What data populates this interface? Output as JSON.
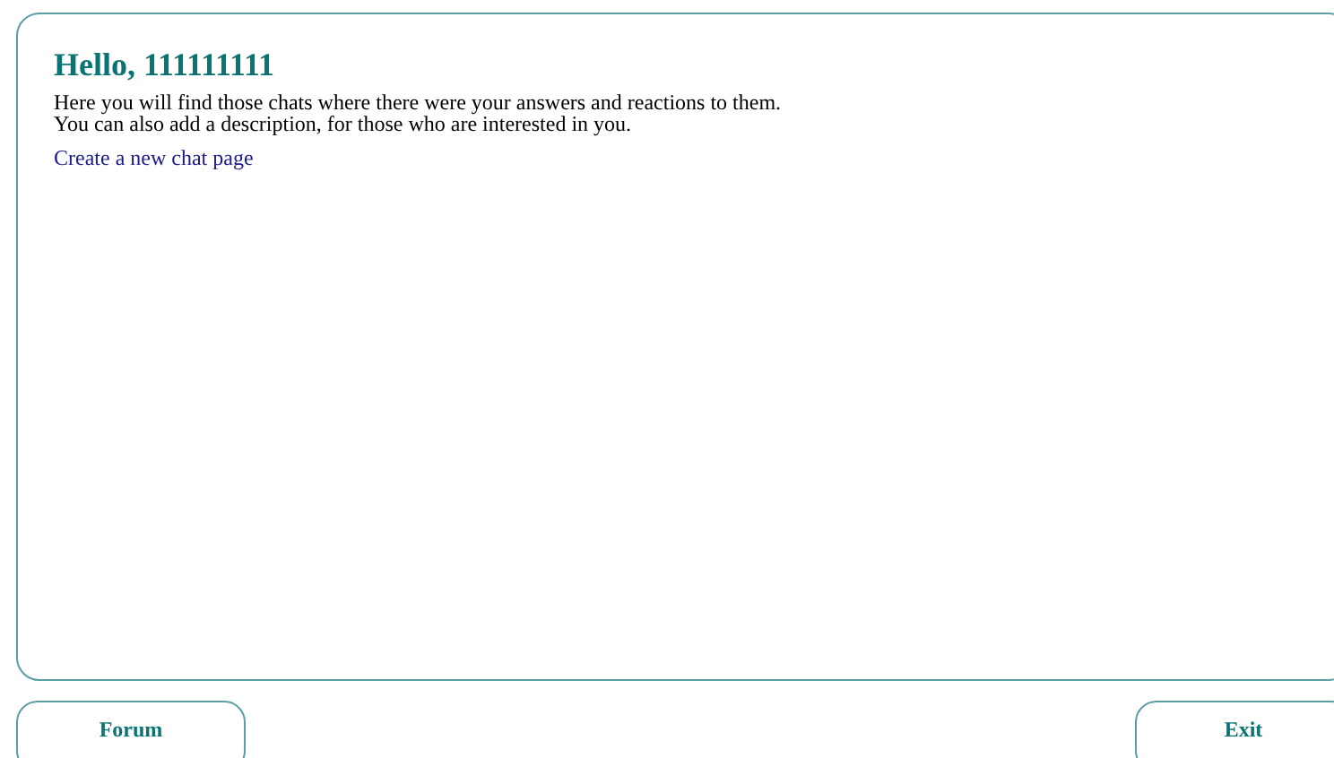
{
  "panel": {
    "title": "Hello, 111111111",
    "lines": [
      "Here you will find those chats where there were your answers and reactions to them.",
      "You can also add a description, for those who are interested in you."
    ],
    "link": "Create a new chat page"
  },
  "buttons": [
    {
      "label": "Forum",
      "kind": "left"
    },
    {
      "label": "Exit",
      "kind": "right"
    }
  ]
}
